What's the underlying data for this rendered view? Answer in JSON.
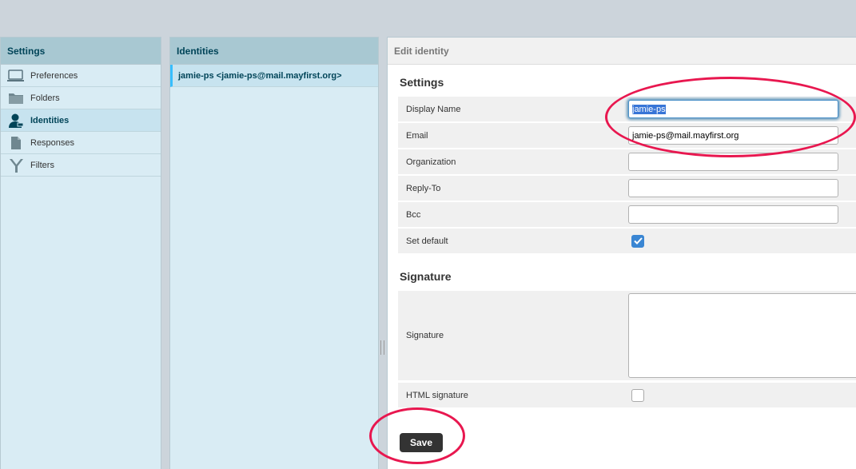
{
  "settings_panel": {
    "title": "Settings",
    "items": [
      {
        "label": "Preferences",
        "icon": "monitor-icon",
        "active": false
      },
      {
        "label": "Folders",
        "icon": "folder-icon",
        "active": false
      },
      {
        "label": "Identities",
        "icon": "user-icon",
        "active": true
      },
      {
        "label": "Responses",
        "icon": "document-icon",
        "active": false
      },
      {
        "label": "Filters",
        "icon": "filter-icon",
        "active": false
      }
    ]
  },
  "identities_panel": {
    "title": "Identities",
    "items": [
      {
        "label": "jamie-ps <jamie-ps@mail.mayfirst.org>"
      }
    ]
  },
  "edit_panel": {
    "title": "Edit identity",
    "settings_section": {
      "title": "Settings",
      "display_name_label": "Display Name",
      "display_name_value": "jamie-ps",
      "email_label": "Email",
      "email_value": "jamie-ps@mail.mayfirst.org",
      "organization_label": "Organization",
      "organization_value": "",
      "reply_to_label": "Reply-To",
      "reply_to_value": "",
      "bcc_label": "Bcc",
      "bcc_value": "",
      "set_default_label": "Set default",
      "set_default_checked": true
    },
    "signature_section": {
      "title": "Signature",
      "signature_label": "Signature",
      "signature_value": "",
      "html_signature_label": "HTML signature",
      "html_signature_checked": false
    },
    "save_label": "Save"
  },
  "colors": {
    "accent": "#37beff",
    "panel_header": "#a8c8d2",
    "panel_bg": "#d9ecf4",
    "annotation": "#e8174f",
    "checkbox_checked": "#3a86d3"
  }
}
